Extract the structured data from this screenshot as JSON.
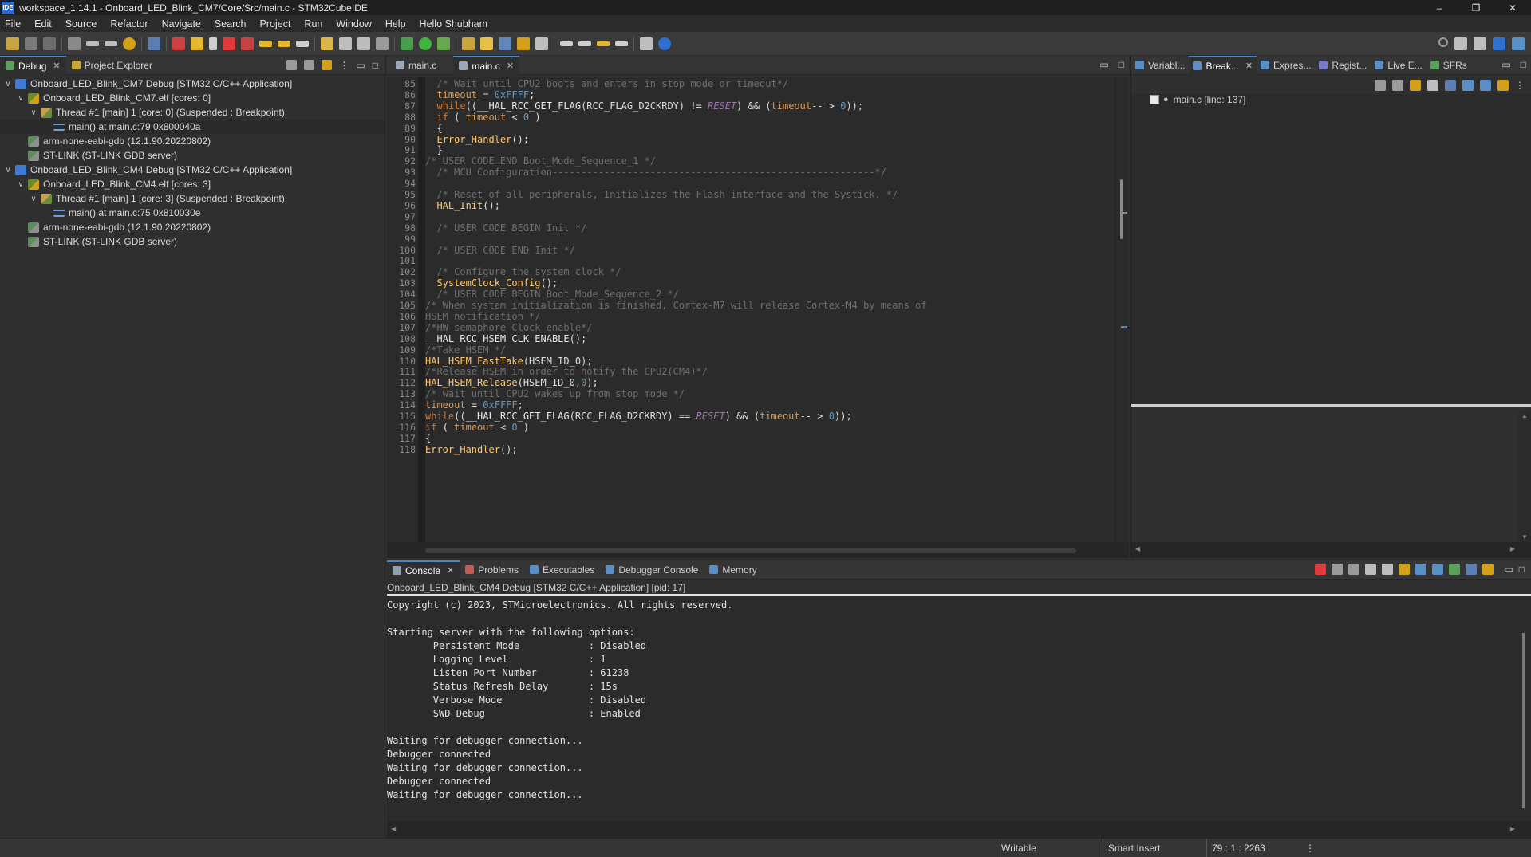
{
  "window": {
    "logo": "IDE",
    "title": "workspace_1.14.1 - Onboard_LED_Blink_CM7/Core/Src/main.c - STM32CubeIDE",
    "minimize": "–",
    "maximize": "❐",
    "close": "✕"
  },
  "menu": [
    "File",
    "Edit",
    "Source",
    "Refactor",
    "Navigate",
    "Search",
    "Project",
    "Run",
    "Window",
    "Help",
    "Hello Shubham"
  ],
  "debug_view": {
    "tabs": [
      {
        "label": "Debug"
      },
      {
        "label": "Project Explorer"
      }
    ],
    "tree": [
      {
        "level": 0,
        "twisty": "∨",
        "icon": "ide",
        "label": "Onboard_LED_Blink_CM7 Debug [STM32 C/C++ Application]"
      },
      {
        "level": 1,
        "twisty": "∨",
        "icon": "elf",
        "label": "Onboard_LED_Blink_CM7.elf [cores: 0]"
      },
      {
        "level": 2,
        "twisty": "∨",
        "icon": "thread",
        "label": "Thread #1 [main] 1 [core: 0] (Suspended : Breakpoint)"
      },
      {
        "level": 3,
        "twisty": "",
        "icon": "frame",
        "label": "main() at main.c:79 0x800040a",
        "selected": true
      },
      {
        "level": 1,
        "twisty": "",
        "icon": "gdb",
        "label": "arm-none-eabi-gdb (12.1.90.20220802)"
      },
      {
        "level": 1,
        "twisty": "",
        "icon": "gdb",
        "label": "ST-LINK (ST-LINK GDB server)"
      },
      {
        "level": 0,
        "twisty": "∨",
        "icon": "ide",
        "label": "Onboard_LED_Blink_CM4 Debug [STM32 C/C++ Application]"
      },
      {
        "level": 1,
        "twisty": "∨",
        "icon": "elf",
        "label": "Onboard_LED_Blink_CM4.elf [cores: 3]"
      },
      {
        "level": 2,
        "twisty": "∨",
        "icon": "thread",
        "label": "Thread #1 [main] 1 [core: 3] (Suspended : Breakpoint)"
      },
      {
        "level": 3,
        "twisty": "",
        "icon": "frame",
        "label": "main() at main.c:75 0x810030e"
      },
      {
        "level": 1,
        "twisty": "",
        "icon": "gdb",
        "label": "arm-none-eabi-gdb (12.1.90.20220802)"
      },
      {
        "level": 1,
        "twisty": "",
        "icon": "gdb",
        "label": "ST-LINK (ST-LINK GDB server)"
      }
    ]
  },
  "editor": {
    "tabs": [
      {
        "label": "main.c",
        "active": false
      },
      {
        "label": "main.c",
        "active": true
      }
    ],
    "lines": [
      {
        "n": "85",
        "html": "  <span class=\"cmt\">/* Wait until CPU2 boots and enters in stop mode or timeout*/</span>"
      },
      {
        "n": "86",
        "html": "  <span class=\"var\">timeout</span> = <span class=\"num\">0xFFFF</span>;"
      },
      {
        "n": "87",
        "html": "  <span class=\"kw\">while</span>((<span class=\"mac\">__HAL_RCC_GET_FLAG</span>(RCC_FLAG_D2CKRDY) != <span class=\"it\">RESET</span>) &amp;&amp; (<span class=\"var\">timeout</span>-- &gt; <span class=\"num\">0</span>));"
      },
      {
        "n": "88",
        "html": "  <span class=\"kw\">if</span> ( <span class=\"var\">timeout</span> &lt; <span class=\"num\">0</span> )"
      },
      {
        "n": "89",
        "html": "  {"
      },
      {
        "n": "90",
        "html": "  <span class=\"fn\">Error_Handler</span>();"
      },
      {
        "n": "91",
        "html": "  }"
      },
      {
        "n": "92",
        "html": "<span class=\"cmt\">/* USER CODE END Boot_Mode_Sequence_1 */</span>"
      },
      {
        "n": "93",
        "html": "  <span class=\"cmt\">/* MCU Configuration--------------------------------------------------------*/</span>"
      },
      {
        "n": "94",
        "html": ""
      },
      {
        "n": "95",
        "html": "  <span class=\"cmt\">/* Reset of all peripherals, Initializes the Flash interface and the Systick. */</span>"
      },
      {
        "n": "96",
        "html": "  <span class=\"fn\">HAL_Init</span>();"
      },
      {
        "n": "97",
        "html": ""
      },
      {
        "n": "98",
        "html": "  <span class=\"cmt\">/* USER CODE BEGIN Init */</span>"
      },
      {
        "n": "99",
        "html": ""
      },
      {
        "n": "100",
        "html": "  <span class=\"cmt\">/* USER CODE END Init */</span>"
      },
      {
        "n": "101",
        "html": ""
      },
      {
        "n": "102",
        "html": "  <span class=\"cmt\">/* Configure the system clock */</span>"
      },
      {
        "n": "103",
        "html": "  <span class=\"fn\">SystemClock_Config</span>();"
      },
      {
        "n": "104",
        "html": "  <span class=\"cmt\">/* USER CODE BEGIN Boot_Mode_Sequence_2 */</span>"
      },
      {
        "n": "105",
        "html": "<span class=\"cmt\">/* When system initialization is finished, Cortex-M7 will release Cortex-M4 by means of</span>"
      },
      {
        "n": "106",
        "html": "<span class=\"cmt\">HSEM notification */</span>"
      },
      {
        "n": "107",
        "html": "<span class=\"cmt\">/*HW semaphore Clock enable*/</span>"
      },
      {
        "n": "108",
        "html": "<span class=\"mac\">__HAL_RCC_HSEM_CLK_ENABLE</span>();"
      },
      {
        "n": "109",
        "html": "<span class=\"cmt\">/*Take HSEM */</span>"
      },
      {
        "n": "110",
        "html": "<span class=\"fn\">HAL_HSEM_FastTake</span>(HSEM_ID_0);"
      },
      {
        "n": "111",
        "html": "<span class=\"cmt\">/*Release HSEM in order to notify the CPU2(CM4)*/</span>"
      },
      {
        "n": "112",
        "html": "<span class=\"fn\">HAL_HSEM_Release</span>(HSEM_ID_0,<span class=\"num\">0</span>);"
      },
      {
        "n": "113",
        "html": "<span class=\"cmt\">/* wait until CPU2 wakes up from stop mode */</span>"
      },
      {
        "n": "114",
        "html": "<span class=\"var\">timeout</span> = <span class=\"num\">0xFFFF</span>;"
      },
      {
        "n": "115",
        "html": "<span class=\"kw\">while</span>((<span class=\"mac\">__HAL_RCC_GET_FLAG</span>(RCC_FLAG_D2CKRDY) == <span class=\"it\">RESET</span>) &amp;&amp; (<span class=\"var\">timeout</span>-- &gt; <span class=\"num\">0</span>));"
      },
      {
        "n": "116",
        "html": "<span class=\"kw\">if</span> ( <span class=\"var\">timeout</span> &lt; <span class=\"num\">0</span> )"
      },
      {
        "n": "117",
        "html": "{"
      },
      {
        "n": "118",
        "html": "<span class=\"fn\">Error_Handler</span>();"
      }
    ]
  },
  "breakpoints_view": {
    "tabs": [
      {
        "label": "Variabl...",
        "active": false
      },
      {
        "label": "Break...",
        "active": true
      },
      {
        "label": "Expres...",
        "active": false
      },
      {
        "label": "Regist...",
        "active": false
      },
      {
        "label": "Live E...",
        "active": false
      },
      {
        "label": "SFRs",
        "active": false
      }
    ],
    "items": [
      {
        "label": "main.c [line: 137]"
      }
    ]
  },
  "console_view": {
    "tabs": [
      {
        "label": "Console",
        "active": true
      },
      {
        "label": "Problems",
        "active": false
      },
      {
        "label": "Executables",
        "active": false
      },
      {
        "label": "Debugger Console",
        "active": false
      },
      {
        "label": "Memory",
        "active": false
      }
    ],
    "process": "Onboard_LED_Blink_CM4 Debug [STM32 C/C++ Application]  [pid: 17]",
    "lines": [
      "Copyright (c) 2023, STMicroelectronics. All rights reserved.",
      "",
      "Starting server with the following options:",
      "        Persistent Mode            : Disabled",
      "        Logging Level              : 1",
      "        Listen Port Number         : 61238",
      "        Status Refresh Delay       : 15s",
      "        Verbose Mode               : Disabled",
      "        SWD Debug                  : Enabled",
      "",
      "Waiting for debugger connection...",
      "Debugger connected",
      "Waiting for debugger connection...",
      "Debugger connected",
      "Waiting for debugger connection..."
    ]
  },
  "status": {
    "writable": "Writable",
    "insert_mode": "Smart Insert",
    "position": "79 : 1 : 2263",
    "more": "⋮"
  },
  "colors": {
    "accent": "#4f86c6",
    "editor_bg": "#2b2b2b",
    "keyword": "#cc7832",
    "function": "#ffc66d",
    "comment": "#6e6e6e",
    "number": "#6897bb"
  }
}
